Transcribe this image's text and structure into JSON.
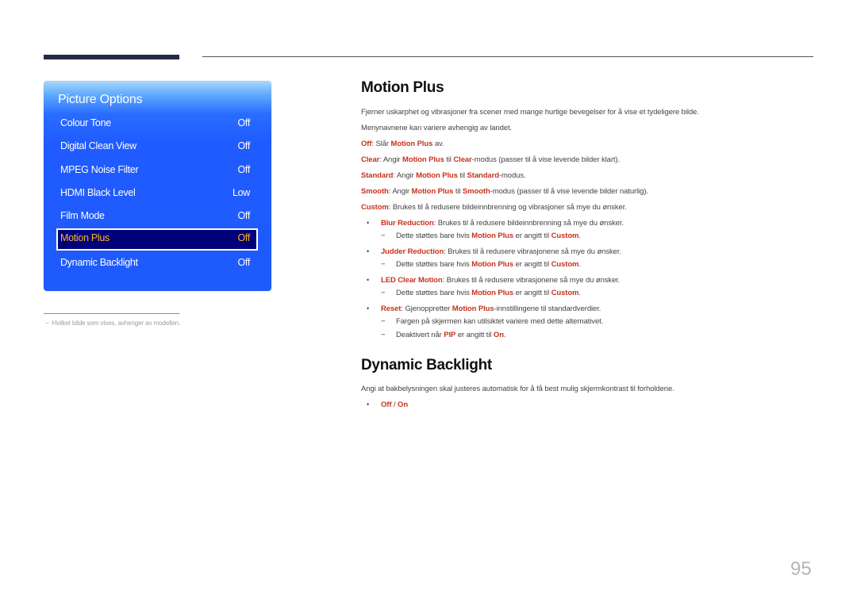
{
  "menu": {
    "title": "Picture Options",
    "items": [
      {
        "label": "Colour Tone",
        "value": "Off"
      },
      {
        "label": "Digital Clean View",
        "value": "Off"
      },
      {
        "label": "MPEG Noise Filter",
        "value": "Off"
      },
      {
        "label": "HDMI Black Level",
        "value": "Low"
      },
      {
        "label": "Film Mode",
        "value": "Off"
      },
      {
        "label": "Motion Plus",
        "value": "Off",
        "selected": true
      },
      {
        "label": "Dynamic Backlight",
        "value": "Off"
      }
    ]
  },
  "footnote": {
    "dash": "−",
    "text": "Hvilket bilde som vises, avhenger av modellen."
  },
  "motion_plus": {
    "title": "Motion Plus",
    "intro": "Fjerner uskarphet og vibrasjoner fra scener med mange hurtige bevegelser for å vise et tydeligere bilde.",
    "note": "Menynavnene kan variere avhengig av landet.",
    "off": {
      "term": "Off",
      "t1": ": Slår ",
      "ref": "Motion Plus",
      "t2": " av."
    },
    "clear": {
      "term": "Clear",
      "t1": ": Angir ",
      "ref": "Motion Plus",
      "t2": " til ",
      "mode": "Clear",
      "t3": "-modus (passer til å vise levende bilder klart)."
    },
    "standard": {
      "term": "Standard",
      "t1": ": Angir ",
      "ref": "Motion Plus",
      "t2": " til ",
      "mode": "Standard",
      "t3": "-modus."
    },
    "smooth": {
      "term": "Smooth",
      "t1": ": Angir ",
      "ref": "Motion Plus",
      "t2": " til ",
      "mode": "Smooth",
      "t3": "-modus (passer til å vise levende bilder naturlig)."
    },
    "custom": {
      "term": "Custom",
      "t1": ": Brukes til å redusere bildeinnbrenning og vibrasjoner så mye du ønsker."
    },
    "bullet_glyph": "•",
    "dash_glyph": "−",
    "sub_items": [
      {
        "term": "Blur Reduction",
        "text": ": Brukes til å redusere bildeinnbrenning så mye du ønsker."
      },
      {
        "term": "Judder Reduction",
        "text": ": Brukes til å redusere vibrasjonene så mye du ønsker."
      },
      {
        "term": "LED Clear Motion",
        "text": ": Brukes til å redusere vibrasjonene så mye du ønsker."
      }
    ],
    "custom_note": {
      "t1": "Dette støttes bare hvis ",
      "ref": "Motion Plus",
      "t2": " er angitt til ",
      "mode": "Custom",
      "t3": "."
    },
    "reset": {
      "term": "Reset",
      "t1": ": Gjenoppretter ",
      "ref": "Motion Plus",
      "t2": "-innstillingene til standardverdier."
    },
    "reset_notes": [
      {
        "text": "Fargen på skjermen kan utilsiktet variere med dette alternativet."
      },
      {
        "t1": "Deaktivert når ",
        "ref": "PIP",
        "t2": " er angitt til ",
        "mode": "On",
        "t3": "."
      }
    ]
  },
  "dynamic_backlight": {
    "title": "Dynamic Backlight",
    "intro": "Angi at bakbelysningen skal justeres automatisk for å få best mulig skjermkontrast til forholdene.",
    "opt_off": "Off",
    "sep": " / ",
    "opt_on": "On"
  },
  "page_number": "95",
  "colors": {
    "accent": "#c8321e",
    "panel_blue": "#1f5bff",
    "selected_bg": "#00007a",
    "selected_text": "#f5b52a"
  }
}
